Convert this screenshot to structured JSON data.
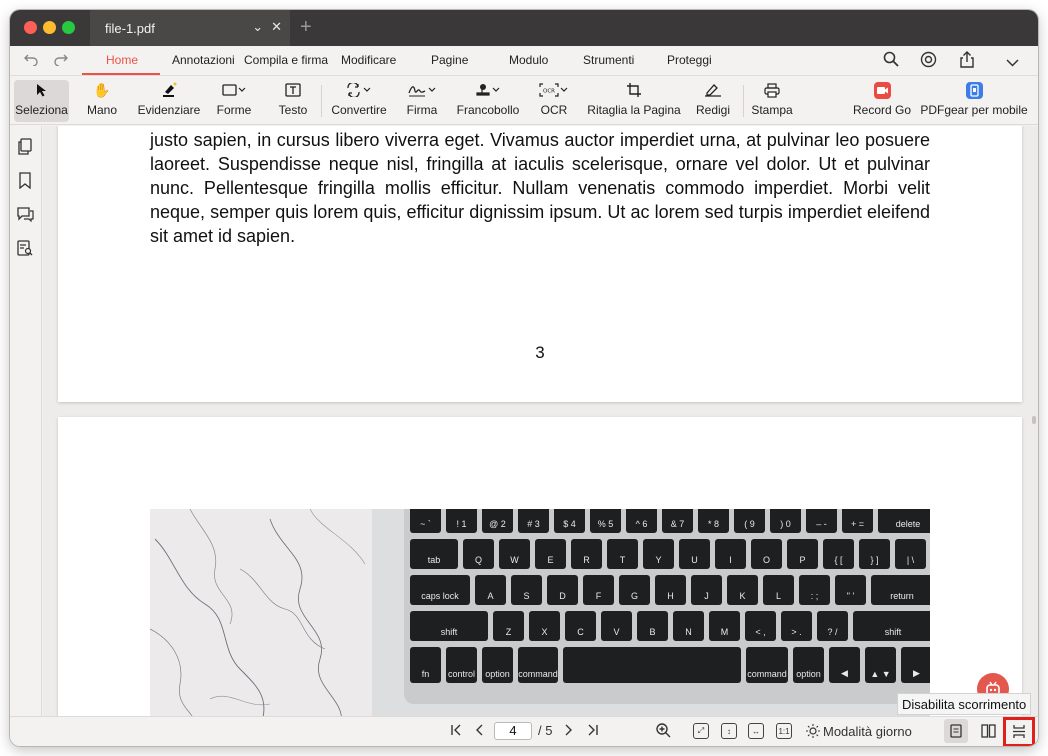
{
  "window": {
    "tab_title": "file-1.pdf"
  },
  "menu": {
    "tabs": [
      "Home",
      "Annotazioni",
      "Compila e firma",
      "Modificare",
      "Pagine",
      "Modulo",
      "Strumenti",
      "Proteggi"
    ],
    "active": "Home"
  },
  "toolbar": {
    "tools": [
      "Seleziona",
      "Mano",
      "Evidenziare",
      "Forme",
      "Testo",
      "Convertire",
      "Firma",
      "Francobollo",
      "OCR",
      "Ritaglia la Pagina",
      "Redigi",
      "Stampa",
      "Record Go",
      "PDFgear per mobile"
    ],
    "selected": "Seleziona"
  },
  "document": {
    "paragraph": "justo sapien, in cursus libero viverra eget. Vivamus auctor imperdiet urna, at pulvinar leo posuere laoreet. Suspendisse neque nisl, fringilla at iaculis scelerisque, ornare vel dolor. Ut et pulvinar nunc. Pellentesque fringilla mollis efficitur. Nullam venenatis commodo imperdiet. Morbi velit neque, semper quis lorem quis, efficitur dignissim ipsum. Ut ac lorem sed turpis imperdiet eleifend sit amet id sapien.",
    "page_number": "3"
  },
  "keyboard": {
    "row1": [
      [
        "~",
        "`"
      ],
      [
        "!",
        "1"
      ],
      [
        "@",
        "2"
      ],
      [
        "#",
        "3"
      ],
      [
        "$",
        "4"
      ],
      [
        "%",
        "5"
      ],
      [
        "^",
        "6"
      ],
      [
        "&",
        "7"
      ],
      [
        "*",
        "8"
      ],
      [
        "(",
        "9"
      ],
      [
        ")",
        "0"
      ],
      [
        "–",
        "-"
      ],
      [
        "+",
        "="
      ],
      [
        "",
        "delete"
      ]
    ],
    "row2": [
      "tab",
      "Q",
      "W",
      "E",
      "R",
      "T",
      "Y",
      "U",
      "I",
      "O",
      "P",
      "{ [",
      "} ]",
      "| \\"
    ],
    "row3": [
      "caps lock",
      "A",
      "S",
      "D",
      "F",
      "G",
      "H",
      "J",
      "K",
      "L",
      ": ;",
      "\" '",
      "return"
    ],
    "row4": [
      "shift",
      "Z",
      "X",
      "C",
      "V",
      "B",
      "N",
      "M",
      "< ,",
      "> .",
      "? /",
      "shift"
    ],
    "row5": [
      "fn",
      "control",
      "option",
      "command",
      "",
      "command",
      "option",
      "◀",
      "▲ ▼",
      "▶"
    ]
  },
  "tooltip": "Disabilita scorrimento",
  "statusbar": {
    "current_page": "4",
    "total_pages": "/ 5",
    "day_mode": "Modalità giorno"
  },
  "colors": {
    "accent": "#e85548",
    "highlight_box": "#e0201b"
  }
}
